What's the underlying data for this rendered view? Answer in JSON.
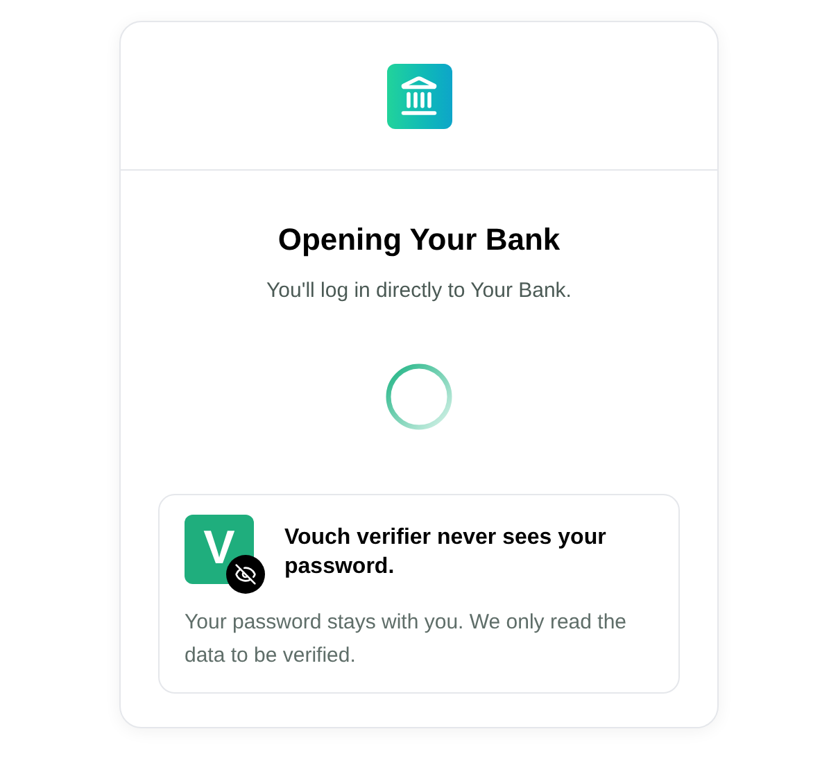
{
  "title": "Opening Your Bank",
  "subtitle": "You'll log in directly to Your Bank.",
  "notice": {
    "logo_letter": "V",
    "heading": "Vouch verifier never sees your password.",
    "body": "Your password stays with you. We only read the data to be verified."
  }
}
